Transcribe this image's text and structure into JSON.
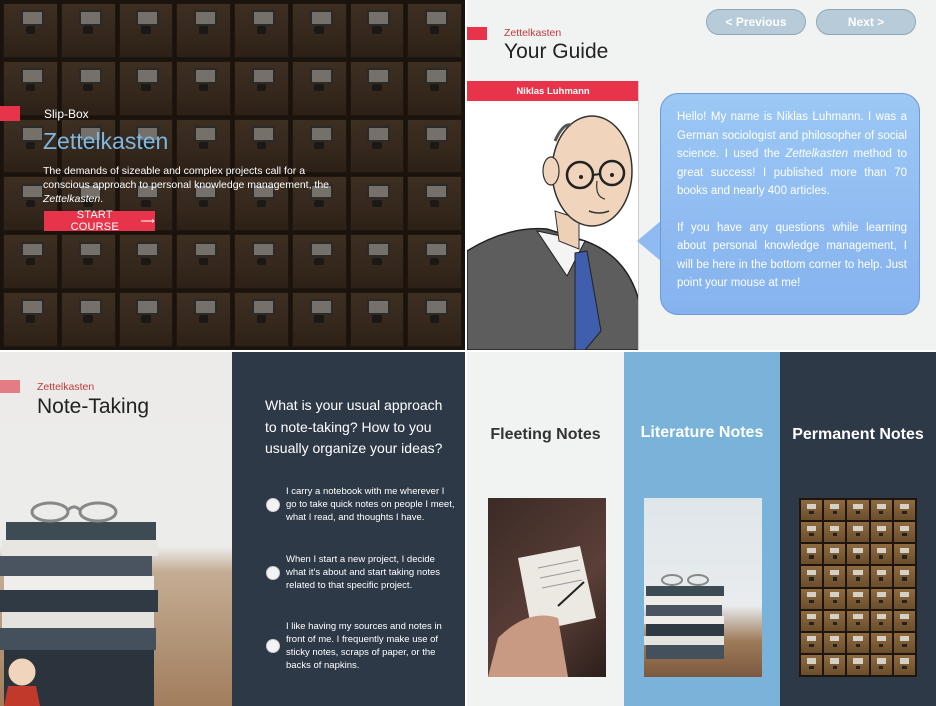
{
  "hero": {
    "eyebrow": "Slip-Box",
    "title": "Zettelkasten",
    "description_before": "The demands of sizeable and complex projects call for a conscious approach to personal knowledge management, the ",
    "description_em": "Zettelkasten",
    "description_after": ".",
    "start_button": "START COURSE",
    "start_arrow": "⟶"
  },
  "guide": {
    "eyebrow": "Zettelkasten",
    "title": "Your Guide",
    "prev_button": "< Previous",
    "next_button": "Next >",
    "name_label": "Niklas Luhmann",
    "bubble_p1_before": "Hello! My name is Niklas Luhmann. I was a German sociologist and philosopher of social science. I used the ",
    "bubble_p1_em": "Zettelkasten",
    "bubble_p1_after": " method to great success! I published more than 70 books and nearly 400 articles.",
    "bubble_p2": "If you have any questions while learning about personal knowledge management, I will be here in the bottom corner to help. Just point your mouse at me!"
  },
  "note_taking": {
    "eyebrow": "Zettelkasten",
    "title": "Note-Taking",
    "question": "What is your usual approach to note-taking? How to you usually organize your ideas?",
    "options": [
      "I carry a notebook with me wherever I go to take quick notes on people I meet, what I read, and thoughts I have.",
      "When I start a new project, I decide what it’s about and start taking notes related to that specific project.",
      "I like having my sources and notes in front of me. I frequently make use of sticky notes, scraps of paper, or the backs of napkins."
    ]
  },
  "note_types": {
    "columns": [
      {
        "title": "Fleeting Notes"
      },
      {
        "title": "Literature Notes"
      },
      {
        "title": "Permanent Notes"
      }
    ]
  },
  "colors": {
    "accent_red": "#e8344a",
    "title_blue": "#7db7e0",
    "dark_navy": "#2e3948",
    "sky_blue": "#79b3d9"
  }
}
